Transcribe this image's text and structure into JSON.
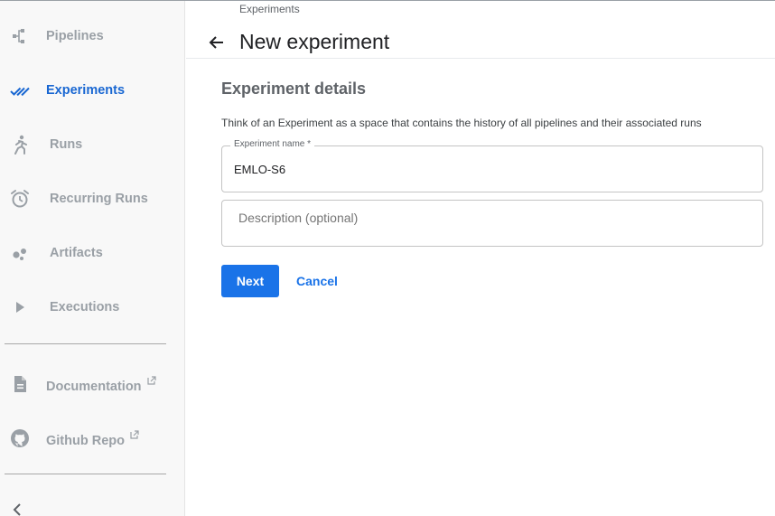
{
  "sidebar": {
    "items": [
      {
        "label": "Pipelines",
        "icon": "pipelines-icon",
        "active": false
      },
      {
        "label": "Experiments",
        "icon": "experiments-icon",
        "active": true
      },
      {
        "label": "Runs",
        "icon": "runs-icon",
        "active": false
      },
      {
        "label": "Recurring Runs",
        "icon": "alarm-clock-icon",
        "active": false
      },
      {
        "label": "Artifacts",
        "icon": "artifacts-icon",
        "active": false
      },
      {
        "label": "Executions",
        "icon": "play-icon",
        "active": false
      }
    ],
    "links": [
      {
        "label": "Documentation",
        "icon": "document-icon",
        "external": true
      },
      {
        "label": "Github Repo",
        "icon": "github-icon",
        "external": true
      }
    ],
    "collapse_icon": "chevron-left-icon"
  },
  "header": {
    "breadcrumb": "Experiments",
    "title": "New experiment",
    "back_icon": "arrow-left-icon"
  },
  "form": {
    "section_title": "Experiment details",
    "description": "Think of an Experiment as a space that contains the history of all pipelines and their associated runs",
    "name_label": "Experiment name *",
    "name_value": "EMLO-S6",
    "description_placeholder": "Description (optional)",
    "next_label": "Next",
    "cancel_label": "Cancel"
  },
  "colors": {
    "accent": "#1a73e8",
    "active_nav": "#1967d2",
    "inactive_nav": "#9aa0a6",
    "sidebar_bg": "#f8f8f8"
  }
}
